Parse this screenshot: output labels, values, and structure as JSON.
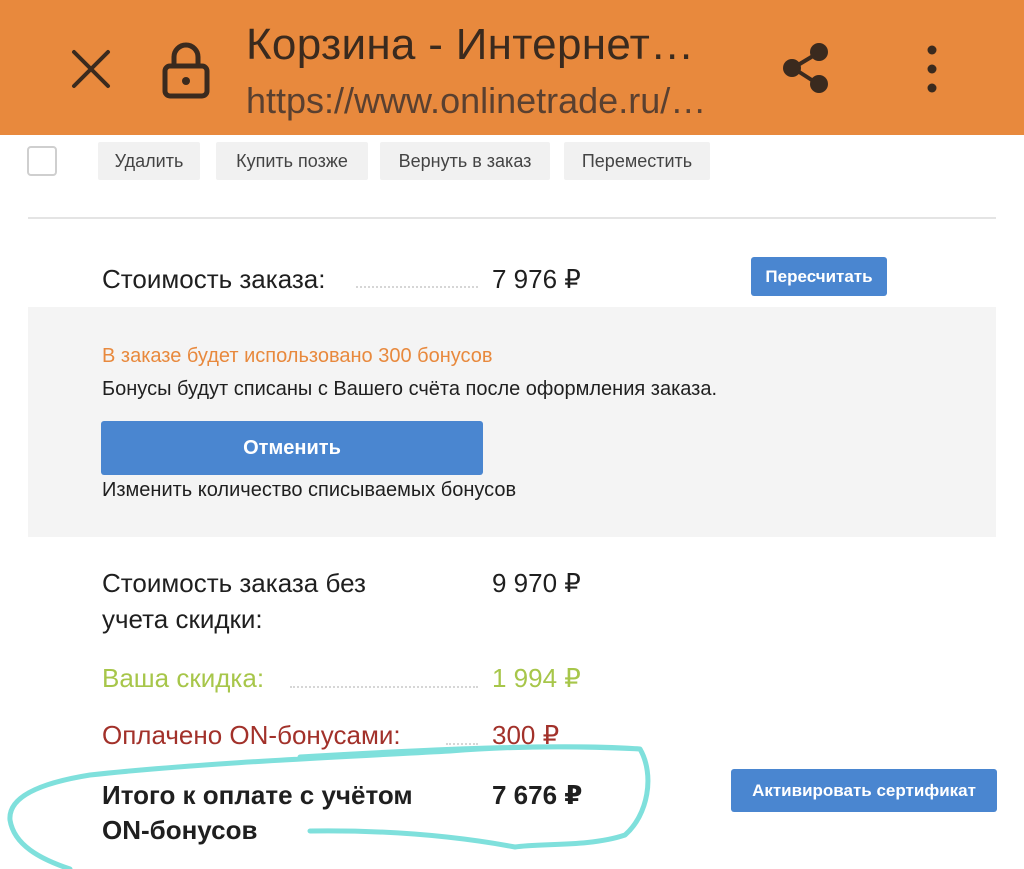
{
  "browser": {
    "title": "Корзина - Интернет…",
    "url": "https://www.onlinetrade.ru/…"
  },
  "actions": {
    "delete": "Удалить",
    "buy_later": "Купить позже",
    "return_to_order": "Вернуть в заказ",
    "move": "Переместить"
  },
  "order": {
    "cost_label": "Стоимость заказа:",
    "cost_value": "7 976 ₽",
    "recalc_button": "Пересчитать"
  },
  "bonus": {
    "note": "В заказе будет использовано 300 бонусов",
    "info": "Бонусы будут списаны с Вашего счёта после оформления заказа.",
    "cancel_button": "Отменить",
    "change_link": "Изменить количество списываемых бонусов"
  },
  "summary": {
    "no_discount_label_line1": "Стоимость заказа без",
    "no_discount_label_line2": "учета скидки:",
    "no_discount_value": "9 970 ₽",
    "discount_label": "Ваша скидка:",
    "discount_value": "1 994 ₽",
    "bonus_paid_label": "Оплачено ON-бонусами:",
    "bonus_paid_value": "300 ₽",
    "total_label_line1": "Итого к оплате с учётом",
    "total_label_line2": "ON-бонусов",
    "total_value": "7 676 ₽",
    "certificate_button": "Активировать сертификат"
  },
  "colors": {
    "topbar": "#e8893d",
    "accent_blue": "#4a86d0",
    "bonus_orange": "#e8893d",
    "discount_green": "#a7c64a",
    "bonus_paid_red": "#a2312a",
    "highlight_cyan": "#7fe0dc"
  },
  "icons": {
    "close": "close-icon",
    "lock": "lock-icon",
    "share": "share-icon",
    "menu": "more-vertical-icon"
  }
}
